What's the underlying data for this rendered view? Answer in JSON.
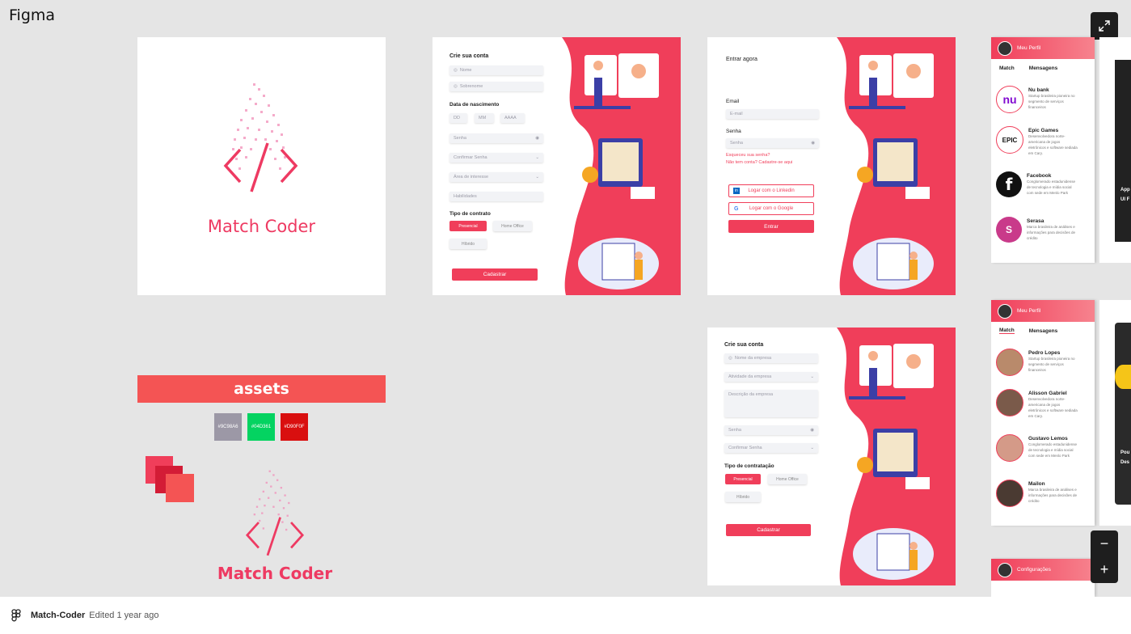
{
  "app": {
    "title": "Figma"
  },
  "controls": {
    "expand_icon": "expand-icon",
    "zoom_out": "−",
    "zoom_in": "+"
  },
  "logo_frame": {
    "name": "Match Coder"
  },
  "signup": {
    "title": "Crie sua conta",
    "first_name": "Nome",
    "last_name": "Sobrenome",
    "birth_label": "Data de nascimento",
    "dd": "DD",
    "mm": "MM",
    "aaaa": "AAAA",
    "password": "Senha",
    "confirm": "Confirmar Senha",
    "interest": "Área de interesse",
    "skills": "Habilidades",
    "contract_label": "Tipo de contrato",
    "presencial": "Presencial",
    "home_office": "Home Office",
    "hibrido": "Híbrido",
    "submit": "Cadastrar"
  },
  "login": {
    "title": "Entrar agora",
    "email_label": "Email",
    "email_placeholder": "E-mail",
    "password_label": "Senha",
    "password_placeholder": "Senha",
    "forgot": "Esqueceu sua senha?",
    "no_account": "Não tem conta? Cadastre-se aqui",
    "linkedin": "Logar com o Linkedin",
    "google": "Logar com o Google",
    "submit": "Entrar"
  },
  "company_signup": {
    "title": "Crie sua conta",
    "company_name": "Nome da empresa",
    "activity": "Atividade da empresa",
    "description": "Descrição da empresa",
    "password": "Senha",
    "confirm": "Confirmar Senha",
    "contract_label": "Tipo de contratação",
    "presencial": "Presencial",
    "home_office": "Home Office",
    "hibrido": "Híbrido",
    "submit": "Cadastrar"
  },
  "assets": {
    "title": "assets",
    "swatches": [
      {
        "label": "#9C98A6",
        "color": "#9C98A6"
      },
      {
        "label": "#04D361",
        "color": "#04D361"
      },
      {
        "label": "#D90F0F",
        "color": "#D90F0F"
      }
    ],
    "name": "Match Coder"
  },
  "match_companies": {
    "header": "Meu Perfil",
    "tab_match": "Match",
    "tab_messages": "Mensagens",
    "items": [
      {
        "name": "Nu bank",
        "desc": "Startup brasileira pioneira no segmento de serviços financeiros",
        "logo": "nu"
      },
      {
        "name": "Epic Games",
        "desc": "Desenvolvedora norte-americana de jogos eletrônicos e software sediada em Cary.",
        "logo": "EPIC"
      },
      {
        "name": "Facebook",
        "desc": "Conglomerado estadunidense de tecnologia e mídia social com sede em Menlo Park",
        "logo": "f"
      },
      {
        "name": "Serasa",
        "desc": "Marca brasileira de análises e informações para decisões de crédito",
        "logo": "S"
      }
    ]
  },
  "match_people": {
    "header": "Meu Perfil",
    "tab_match": "Match",
    "tab_messages": "Mensagens",
    "items": [
      {
        "name": "Pedro Lopes",
        "desc": "Startup brasileira pioneira no segmento de serviços financeiros"
      },
      {
        "name": "Alisson Gabriel",
        "desc": "Desenvolvedora norte-americana de jogos eletrônicos e software sediada em Cary."
      },
      {
        "name": "Gustavo Lemos",
        "desc": "Conglomerado estadunidense de tecnologia e mídia social com sede em Menlo Park"
      },
      {
        "name": "Mailon",
        "desc": "Marca brasileira de análises e informações para decisões de crédito"
      }
    ]
  },
  "settings": {
    "header": "Configurações"
  },
  "partial": {
    "app": "App",
    "ui": "UI F",
    "pou": "Pou",
    "des": "Des"
  },
  "footer": {
    "file_name": "Match-Coder",
    "edited": "Edited 1 year ago"
  }
}
